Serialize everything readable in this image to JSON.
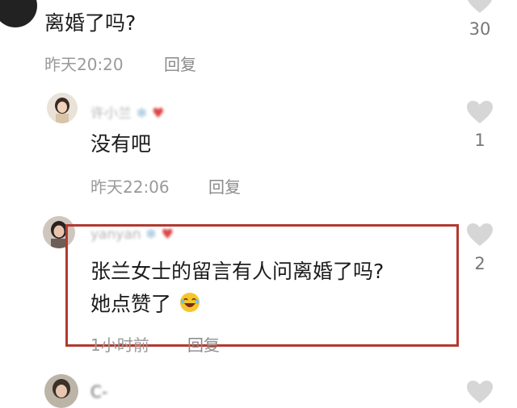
{
  "comments": [
    {
      "text": "离婚了吗?",
      "time": "昨天20:20",
      "reply": "回复",
      "likes": "30"
    },
    {
      "username": "许小兰",
      "text": "没有吧",
      "time": "昨天22:06",
      "reply": "回复",
      "likes": "1"
    },
    {
      "username": "yanyan",
      "line1": "张兰女士的留言有人问离婚了吗?",
      "line2": "她点赞了",
      "time": "1小时前",
      "reply": "回复",
      "likes": "2"
    },
    {
      "username": "C-"
    }
  ],
  "colors": {
    "highlight_border": "#b23a30",
    "heart": "#d6d6d6",
    "meta_text": "#9a9a9a"
  },
  "icons": [
    "heart-icon",
    "laughing-emoji-icon",
    "snowflake-emoji-icon",
    "heart-emoji-icon"
  ]
}
